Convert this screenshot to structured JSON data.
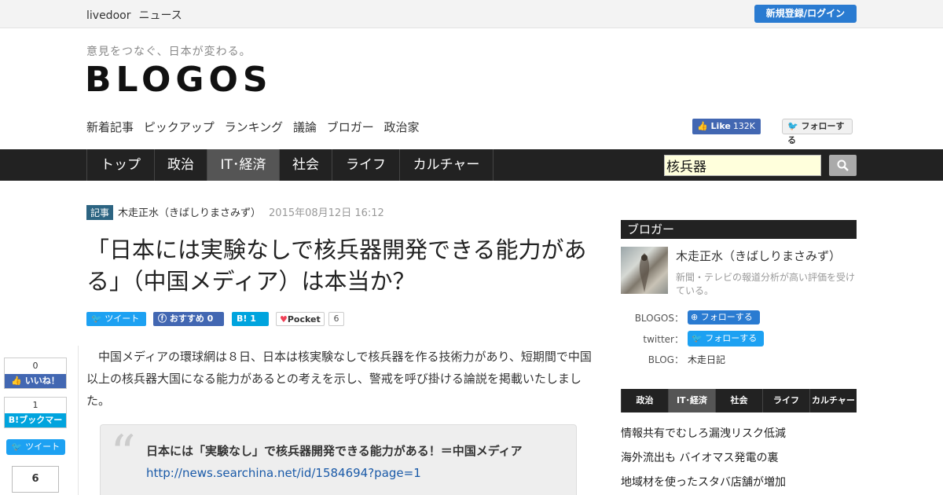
{
  "topbar": {
    "brand_1": "livedoor",
    "brand_2": "ニュース",
    "login": "新規登録/ログイン"
  },
  "header": {
    "tagline": "意見をつなぐ、日本が変わる。",
    "logo": "BLOGOS",
    "subnav": [
      "新着記事",
      "ピックアップ",
      "ランキング",
      "議論",
      "ブロガー",
      "政治家"
    ],
    "fb_like": "Like",
    "fb_like_count": "132K",
    "tw_follow": "フォローする"
  },
  "catnav": {
    "tabs": [
      "トップ",
      "政治",
      "IT･経済",
      "社会",
      "ライフ",
      "カルチャー"
    ],
    "active": "IT･経済"
  },
  "search": {
    "value": "核兵器",
    "icon": "search-icon"
  },
  "article": {
    "badge": "記事",
    "author": "木走正水（きばしりまさみず）",
    "date": "2015年08月12日 16:12",
    "title": "「日本には実験なしで核兵器開発できる能力がある」（中国メディア）は本当か？",
    "share": {
      "tweet": "ツイート",
      "fb": "おすすめ 0",
      "hatena": "1",
      "pocket": "Pocket",
      "pocket_count": "6"
    },
    "body": "中国メディアの環球網は８日、日本は核実験なしで核兵器を作る技術力があり、短期間で中国以上の核兵器大国になる能力があるとの考えを示し、警戒を呼び掛ける論説を掲載いたしました。",
    "quote": {
      "title": "日本には「実験なし」で核兵器開発できる能力がある！＝中国メディア",
      "link": "http://news.searchina.net/id/1584694?page=1"
    }
  },
  "floating_share": {
    "fb_count": "0",
    "fb_label": "いいね！",
    "hb_count": "1",
    "hb_label": "B!ブックマーク",
    "tweet": "ツイート",
    "pocket_count": "6"
  },
  "sidebar": {
    "heading": "ブロガー",
    "blogger_name": "木走正水（きばしりまさみず）",
    "blogger_desc": "新聞・テレビの報道分析が高い評価を受けている。",
    "blogos_label": "BLOGOS：",
    "blogos_follow": "フォローする",
    "twitter_label": "twitter：",
    "twitter_follow": "フォローする",
    "blog_label": "BLOG：",
    "blog_value": "木走日記",
    "tabs": [
      "政治",
      "IT･経済",
      "社会",
      "ライフ",
      "カルチャー"
    ],
    "active_tab": "IT･経済",
    "items": [
      "情報共有でむしろ漏洩リスク低減",
      "海外流出も バイオマス発電の裏",
      "地域材を使ったスタバ店舗が増加"
    ]
  },
  "colors": {
    "nav_bg": "#222222",
    "login_blue": "#2a7bd1",
    "twitter": "#1da1f2",
    "facebook": "#4267b2",
    "hatena": "#00a4de"
  }
}
